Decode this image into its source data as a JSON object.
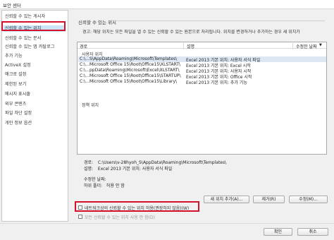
{
  "window": {
    "title": "보안 센터"
  },
  "sidebar": {
    "items": [
      {
        "label": "신뢰할 수 있는 게시자"
      },
      {
        "label": "신뢰할 수 있는 위치"
      },
      {
        "label": "신뢰할 수 있는 문서"
      },
      {
        "label": "신뢰할 수 있는 앱 카탈로그"
      },
      {
        "label": "추가 기능"
      },
      {
        "label": "ActiveX 설정"
      },
      {
        "label": "매크로 설정"
      },
      {
        "label": "제한된 보기"
      },
      {
        "label": "메시지 표시줄"
      },
      {
        "label": "외부 콘텐츠"
      },
      {
        "label": "파일 차단 설정"
      },
      {
        "label": "개인 정보 옵션"
      }
    ],
    "selected_index": 1
  },
  "main": {
    "section_title": "신뢰할 수 있는 위치",
    "warning": "경고: 해당 위치는 모든 파일을 열 수 있는 신뢰할 수 있는 원본으로 처리됩니다. 위치를 변경하거나 추가하는 경우 새 위치가",
    "columns": {
      "path": "경로",
      "description": "설명",
      "modified": "수정한 날짜"
    },
    "sort_indicator": "▼",
    "user_locations_label": "사용자 위치",
    "user_locations": [
      {
        "path": "C:\\...S\\AppData\\Roaming\\Microsoft\\Templates\\",
        "description": "Excel 2013 기본 위치: 사용자 서식 파일"
      },
      {
        "path": "C:\\...Microsoft Office 15\\Root\\Office15\\XLSTART\\",
        "description": "Excel 2013 기본 위치: Excel 시작"
      },
      {
        "path": "C:\\...ppData\\Roaming\\Microsoft\\Excel\\XLSTART\\",
        "description": "Excel 2013 기본 위치: 사용자 시작"
      },
      {
        "path": "C:\\...Microsoft Office 15\\Root\\Office15\\STARTUP\\",
        "description": "Excel 2013 기본 위치: Office 시작"
      },
      {
        "path": "C:\\...Microsoft Office 15\\Root\\Office15\\Library\\",
        "description": "Excel 2013 기본 위치: 추가 기능"
      }
    ],
    "selected_row": 0,
    "policy_locations_label": "정책 위치",
    "details": {
      "path_label": "경로:",
      "path_value": "C:\\Users\\v-28hyoh_S\\AppData\\Roaming\\Microsoft\\Templates\\",
      "description_label": "설명:",
      "description_value": "Excel 2013 기본 위치: 사용자 서식 파일",
      "modified_label": "수정한 날짜:",
      "modified_value": "",
      "subfolders_label": "하위 폴더:",
      "subfolders_value": "허용 안 함"
    },
    "buttons": {
      "add": "새 위치 추가(A)...",
      "remove": "제거(R)",
      "modify": "수정(M)..."
    },
    "checkboxes": {
      "allow_network": "네트워크상의 신뢰할 수 있는 위치 허용(권장하지 않음)(W)",
      "disable_all": "모든 신뢰할 수 있는 위치 사용 안 함(D)"
    }
  },
  "footer": {
    "ok": "확인",
    "cancel": "취소"
  },
  "colors": {
    "highlight_box": "#d4112b",
    "selected": "#cce4f7"
  }
}
